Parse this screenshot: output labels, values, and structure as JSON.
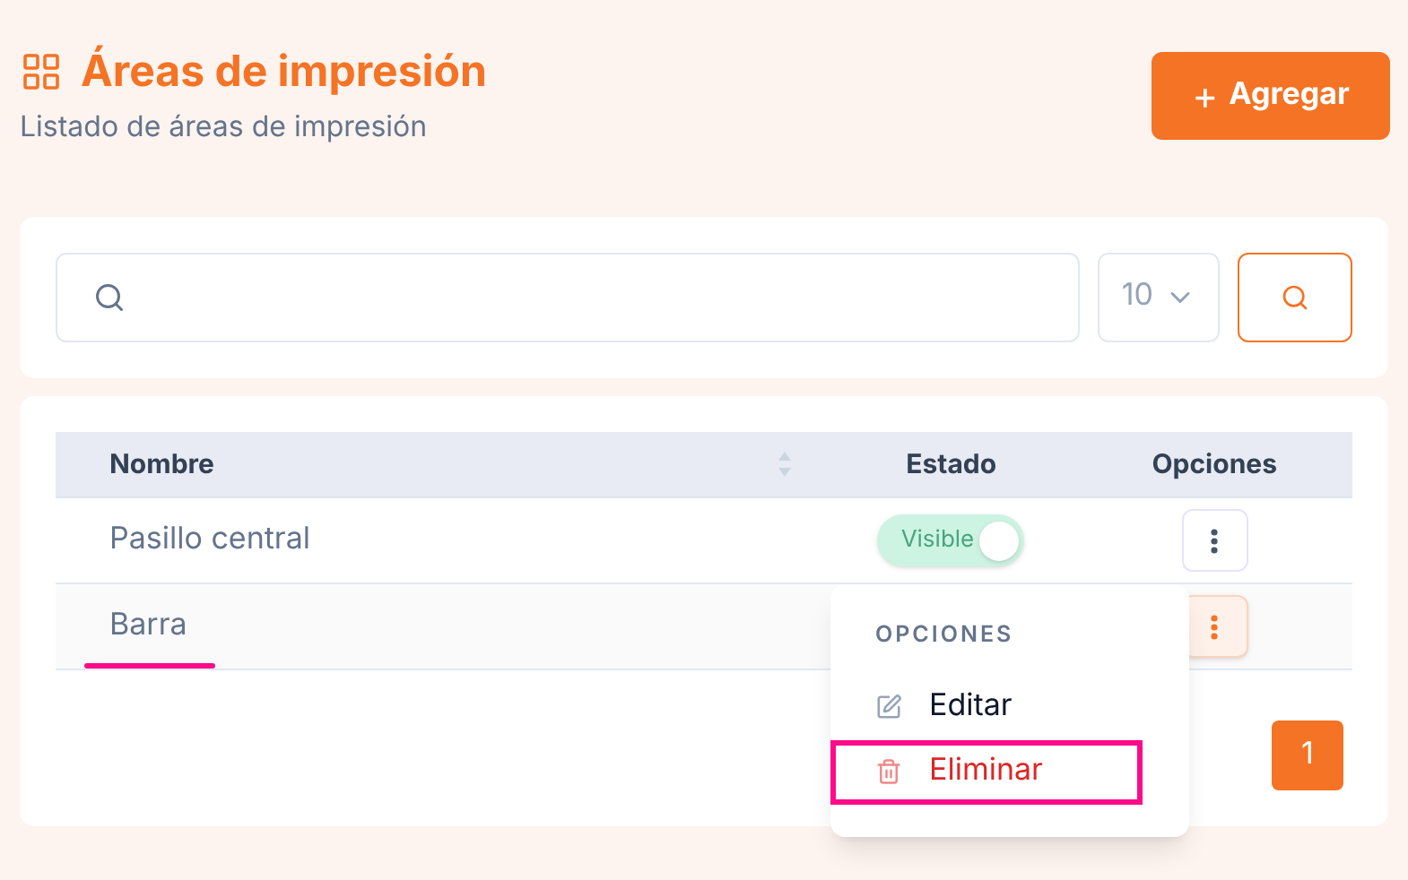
{
  "header": {
    "title": "Áreas de impresión",
    "subtitle": "Listado de áreas de impresión",
    "add_button": "Agregar",
    "add_icon": "+"
  },
  "filters": {
    "page_size": "10"
  },
  "table": {
    "columns": [
      "Nombre",
      "Estado",
      "Opciones"
    ],
    "rows": [
      {
        "name": "Pasillo central",
        "underlined": false,
        "status": {
          "label": "Visible",
          "on": true
        },
        "menu_open": false
      },
      {
        "name": "Barra",
        "underlined": true,
        "menu_open": true
      }
    ]
  },
  "menu": {
    "heading": "OPCIONES",
    "items": [
      {
        "kind": "edit",
        "label": "Editar",
        "highlighted": false
      },
      {
        "kind": "delete",
        "label": "Eliminar",
        "highlighted": true
      }
    ]
  },
  "pagination": [
    {
      "label": "1",
      "selected": true
    }
  ]
}
